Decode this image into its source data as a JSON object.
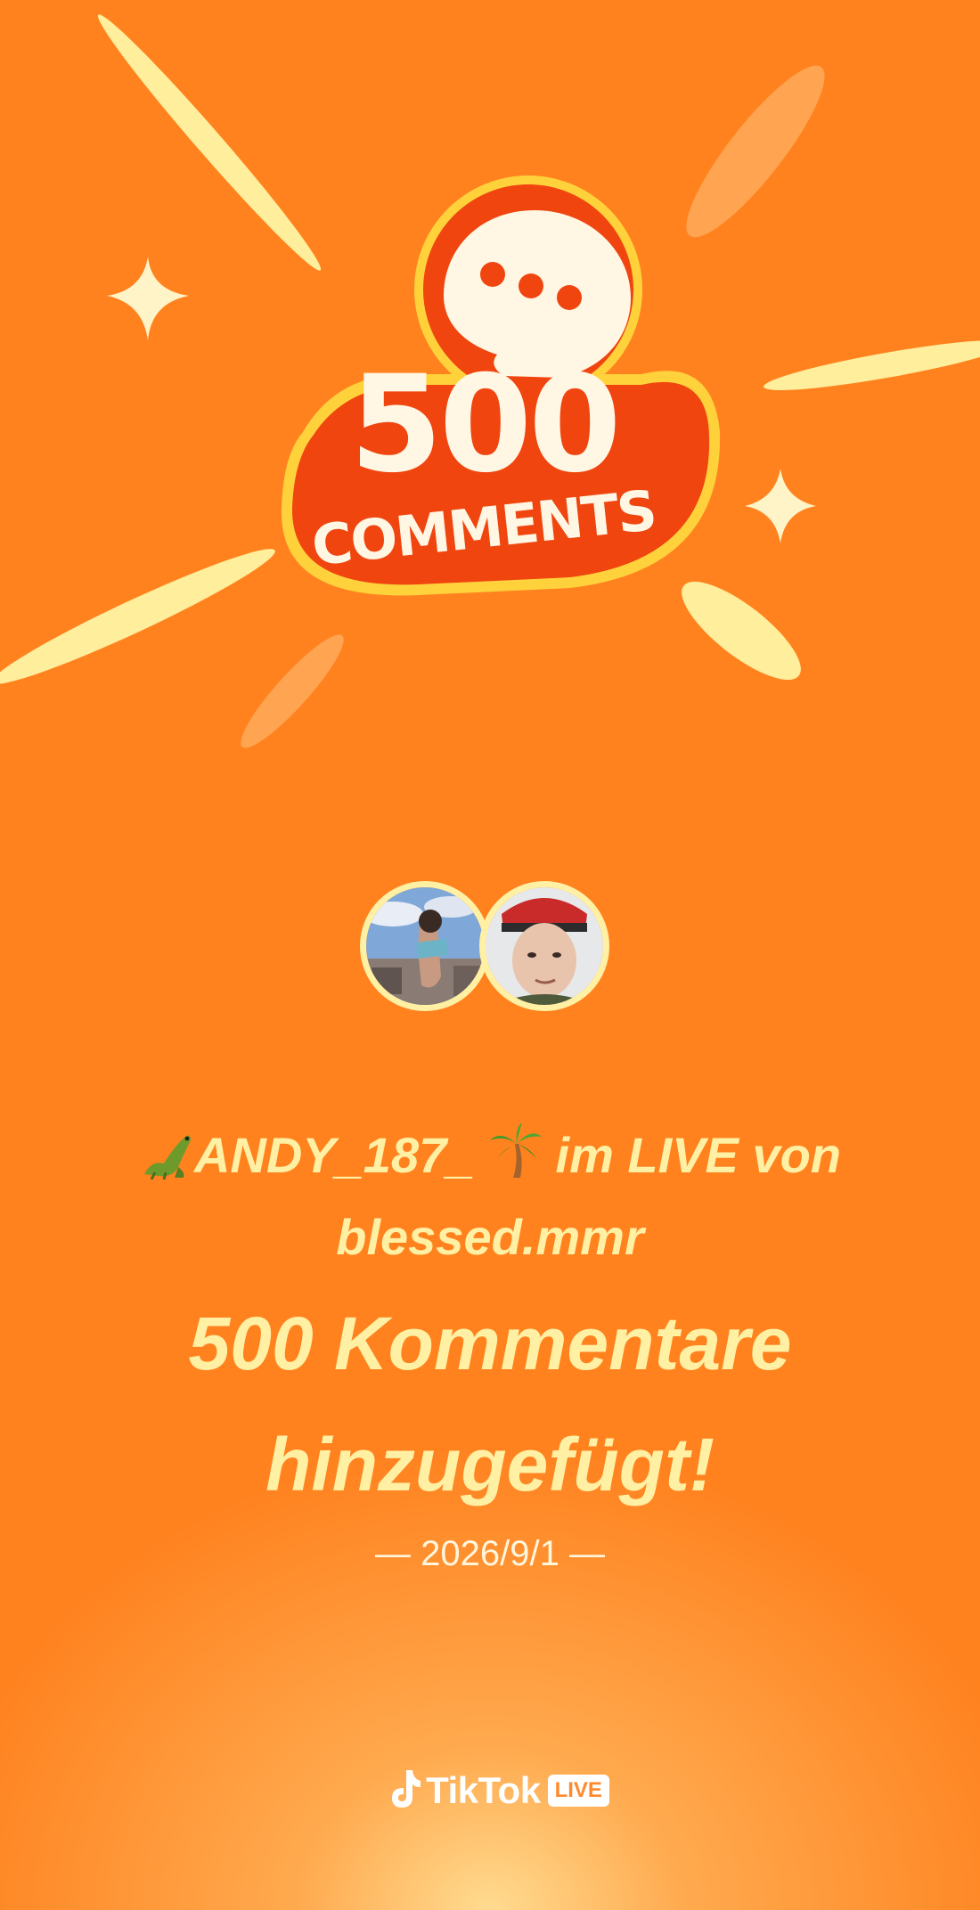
{
  "badge": {
    "number": "500",
    "word": "COMMENTS"
  },
  "headline": {
    "user": "ANDY_187_",
    "connector": "im LIVE von",
    "host": "blessed.mmr"
  },
  "message": {
    "line1": "500 Kommentare",
    "line2": "hinzugefügt!"
  },
  "date": "— 2026/9/1 —",
  "brand": {
    "name": "TikTok",
    "badge": "LIVE"
  },
  "icons": {
    "left": "crocodile-icon",
    "right": "palm-tree-icon",
    "badge": "chat-bubble-icon",
    "brand": "music-note-icon"
  },
  "colors": {
    "background": "#ff821f",
    "text": "#fff0a4",
    "badge_red": "#f0450f",
    "badge_rim": "#ffd23c",
    "cream": "#fff6e4",
    "rays": "#ffee9c"
  }
}
